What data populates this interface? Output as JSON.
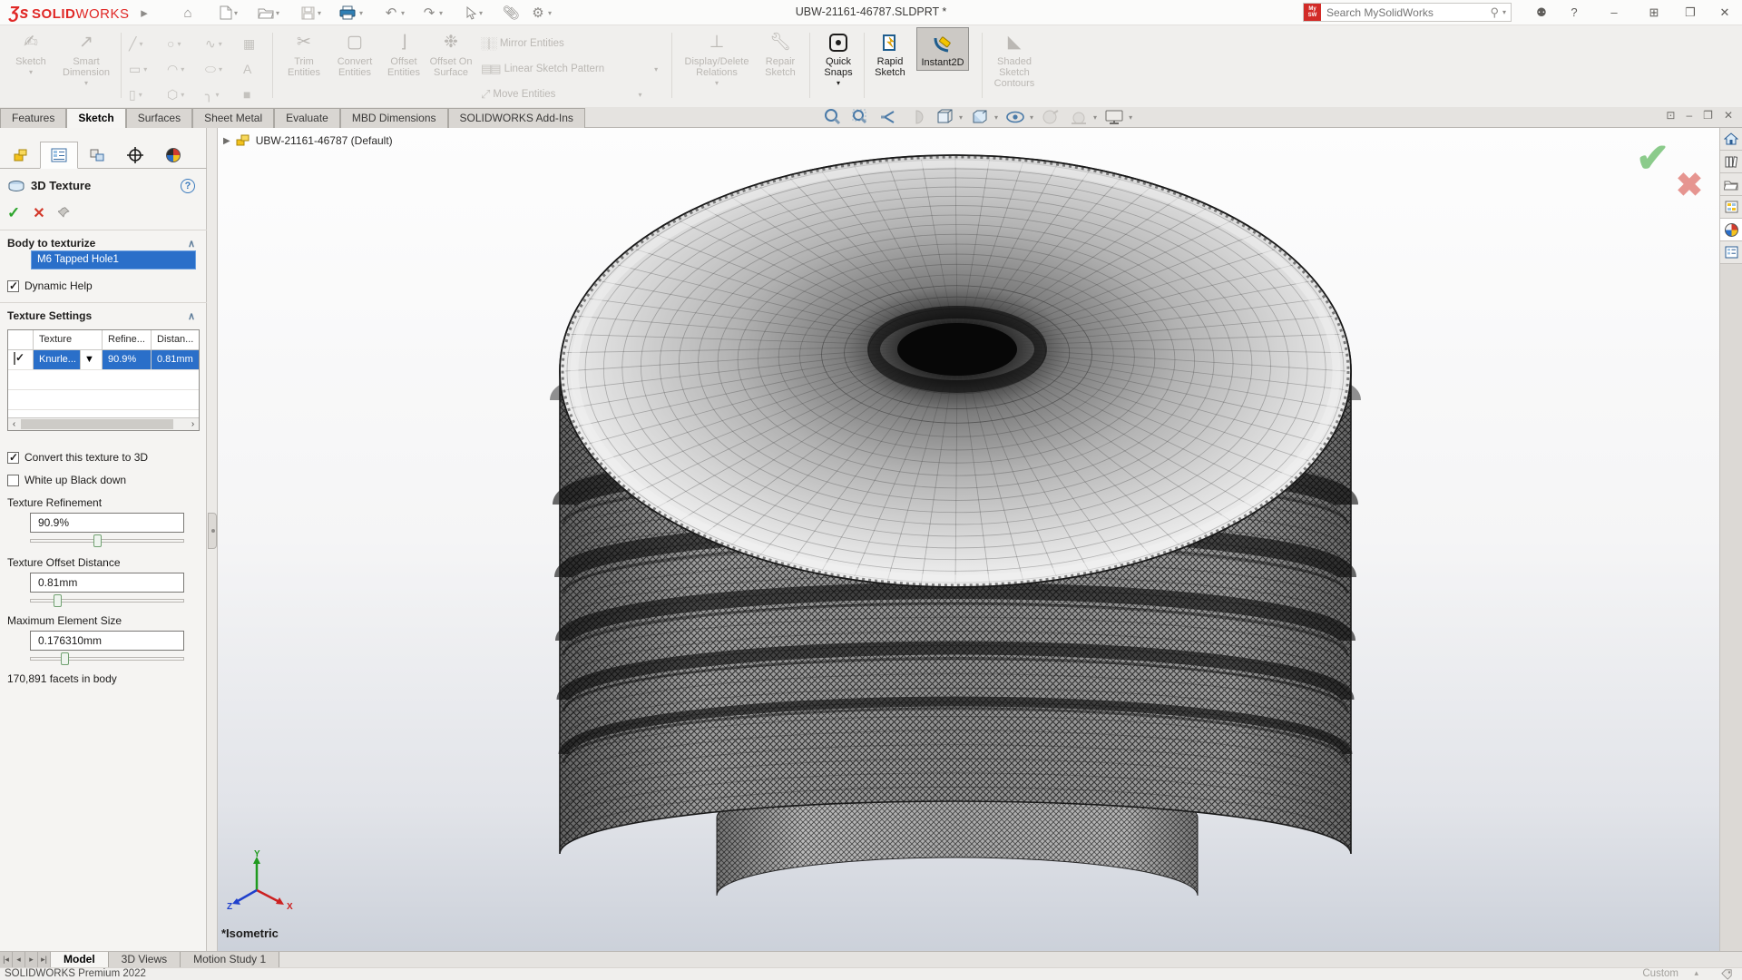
{
  "titlebar": {
    "logo_mark": "Ʒs",
    "logo_solid": "SOLID",
    "logo_works": "WORKS",
    "document_title": "UBW-21161-46787.SLDPRT *",
    "search_placeholder": "Search MySolidWorks",
    "mysw_badge": "My SW"
  },
  "ribbon": {
    "sketch": "Sketch",
    "smart_dimension": "Smart Dimension",
    "trim_entities": "Trim Entities",
    "convert_entities": "Convert Entities",
    "offset_entities": "Offset Entities",
    "offset_on_surface": "Offset On Surface",
    "mirror_entities": "Mirror Entities",
    "linear_sketch_pattern": "Linear Sketch Pattern",
    "move_entities": "Move Entities",
    "display_delete_relations": "Display/Delete Relations",
    "repair_sketch": "Repair Sketch",
    "quick_snaps": "Quick Snaps",
    "rapid_sketch": "Rapid Sketch",
    "instant2d": "Instant2D",
    "shaded_sketch_contours": "Shaded Sketch Contours"
  },
  "command_tabs": {
    "items": [
      "Features",
      "Sketch",
      "Surfaces",
      "Sheet Metal",
      "Evaluate",
      "MBD Dimensions",
      "SOLIDWORKS Add-Ins"
    ],
    "active": "Sketch"
  },
  "property_manager": {
    "title": "3D Texture",
    "body_group_label": "Body to texturize",
    "selected_body": "M6 Tapped Hole1",
    "dynamic_help_label": "Dynamic Help",
    "texture_settings_label": "Texture Settings",
    "table": {
      "columns": [
        "Texture",
        "Refine...",
        "Distan..."
      ],
      "row": {
        "checked": true,
        "texture": "Knurle...",
        "refinement": "90.9%",
        "distance": "0.81mm"
      }
    },
    "convert_label": "Convert this texture to 3D",
    "convert_checked": true,
    "white_up_label": "White up Black down",
    "white_up_checked": false,
    "refinement": {
      "label": "Texture Refinement",
      "value": "90.9%",
      "slider_pct": 41
    },
    "offset_distance": {
      "label": "Texture Offset Distance",
      "value": "0.81mm",
      "slider_pct": 15
    },
    "max_element": {
      "label": "Maximum Element Size",
      "value": "0.176310mm",
      "slider_pct": 20
    },
    "facets_text": "170,891 facets in body"
  },
  "viewport": {
    "tree_item": "UBW-21161-46787 (Default)",
    "view_orientation_label": "*Isometric",
    "triad": {
      "x": "X",
      "y": "Y",
      "z": "Z"
    },
    "confirm_check": "✔",
    "confirm_cancel": "✖"
  },
  "bottom_tabs": {
    "items": [
      "Model",
      "3D Views",
      "Motion Study 1"
    ],
    "active": "Model"
  },
  "statusbar": {
    "left": "SOLIDWORKS Premium 2022",
    "units": "Custom"
  }
}
